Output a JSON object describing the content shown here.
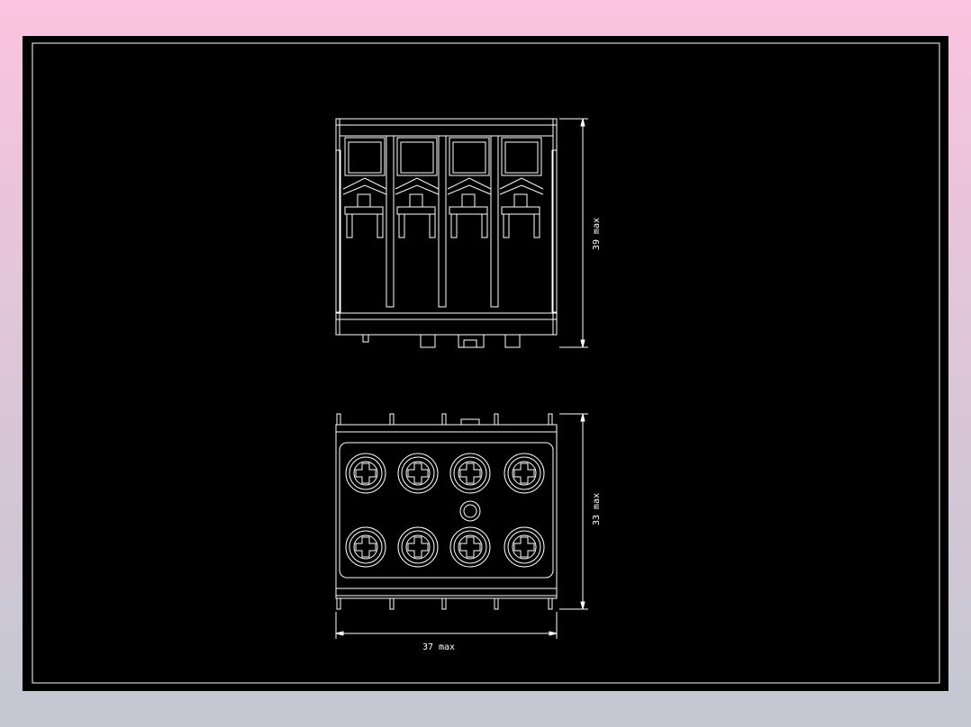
{
  "colors": {
    "line": "#ffffff",
    "background": "#000000",
    "frame_gradient_top": "#fbc3df",
    "frame_gradient_bottom": "#c4c7d2"
  },
  "dimensions": {
    "height_front": "39 max",
    "height_bottom": "33 max",
    "width": "37 max"
  },
  "views": {
    "front": {
      "pole_count": 4
    },
    "bottom": {
      "terminal_rows": 2,
      "terminals_per_row": 4,
      "center_hole": true
    }
  }
}
